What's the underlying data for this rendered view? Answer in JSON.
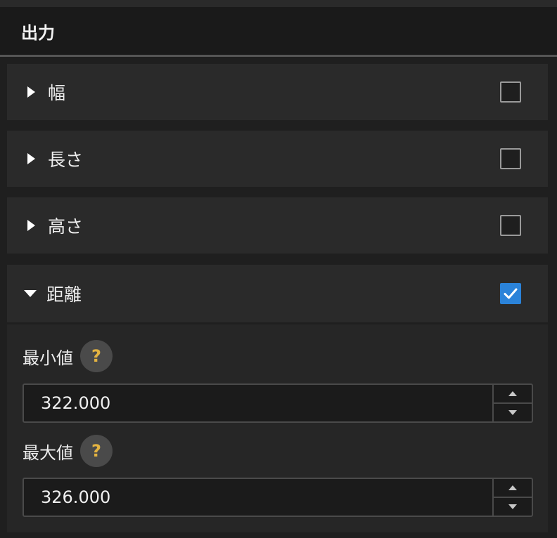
{
  "header": {
    "title": "出力"
  },
  "sections": [
    {
      "label": "幅",
      "expanded": false,
      "checked": false
    },
    {
      "label": "長さ",
      "expanded": false,
      "checked": false
    },
    {
      "label": "高さ",
      "expanded": false,
      "checked": false
    },
    {
      "label": "距離",
      "expanded": true,
      "checked": true
    }
  ],
  "distance": {
    "min": {
      "label": "最小値",
      "help": "?",
      "value": "322.000"
    },
    "max": {
      "label": "最大値",
      "help": "?",
      "value": "326.000"
    }
  },
  "colors": {
    "accent": "#2b83d9",
    "help_mark": "#e3b341"
  },
  "icons": {
    "collapsed": "caret-right-icon",
    "expanded": "caret-down-icon",
    "help": "question-mark-icon",
    "check": "checkmark-icon"
  }
}
